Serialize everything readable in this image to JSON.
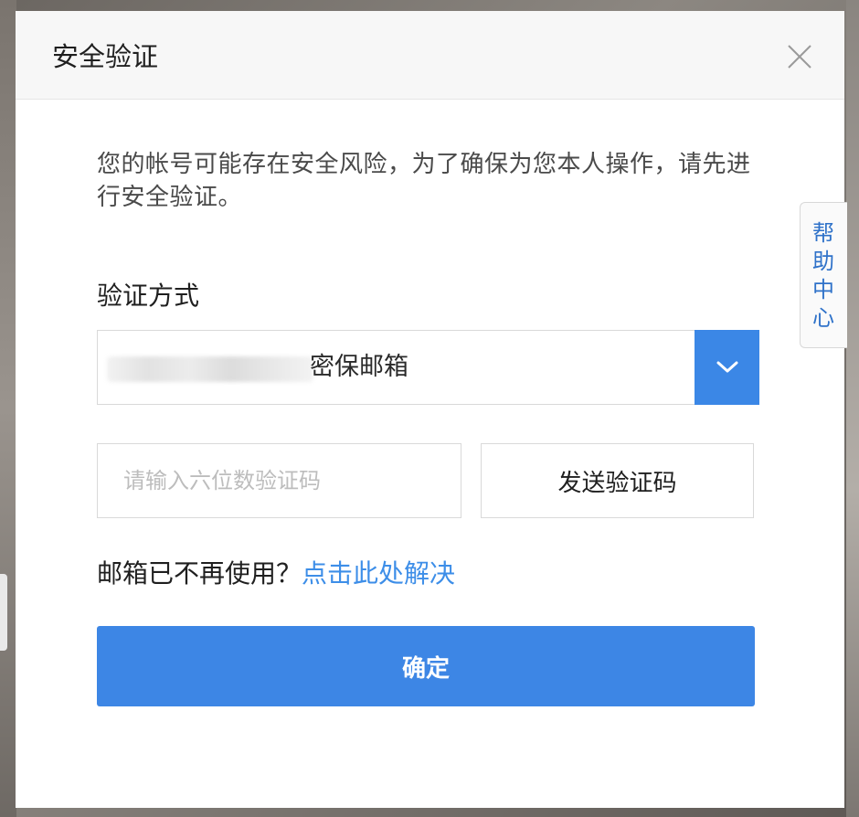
{
  "dialog": {
    "title": "安全验证",
    "description": "您的帐号可能存在安全风险，为了确保为您本人操作，请先进行安全验证。"
  },
  "verify_method": {
    "label": "验证方式",
    "selected_suffix": "密保邮箱",
    "arrow_icon": "chevron-down-icon"
  },
  "code": {
    "placeholder": "请输入六位数验证码",
    "value": "",
    "send_label": "发送验证码"
  },
  "email_help": {
    "question": "邮箱已不再使用？",
    "link_label": "点击此处解决"
  },
  "confirm_label": "确定",
  "help_center": {
    "label": "帮助中心"
  },
  "colors": {
    "primary": "#3d86e5",
    "link": "#3d8ee8",
    "header_bg": "#f7f7f7"
  }
}
